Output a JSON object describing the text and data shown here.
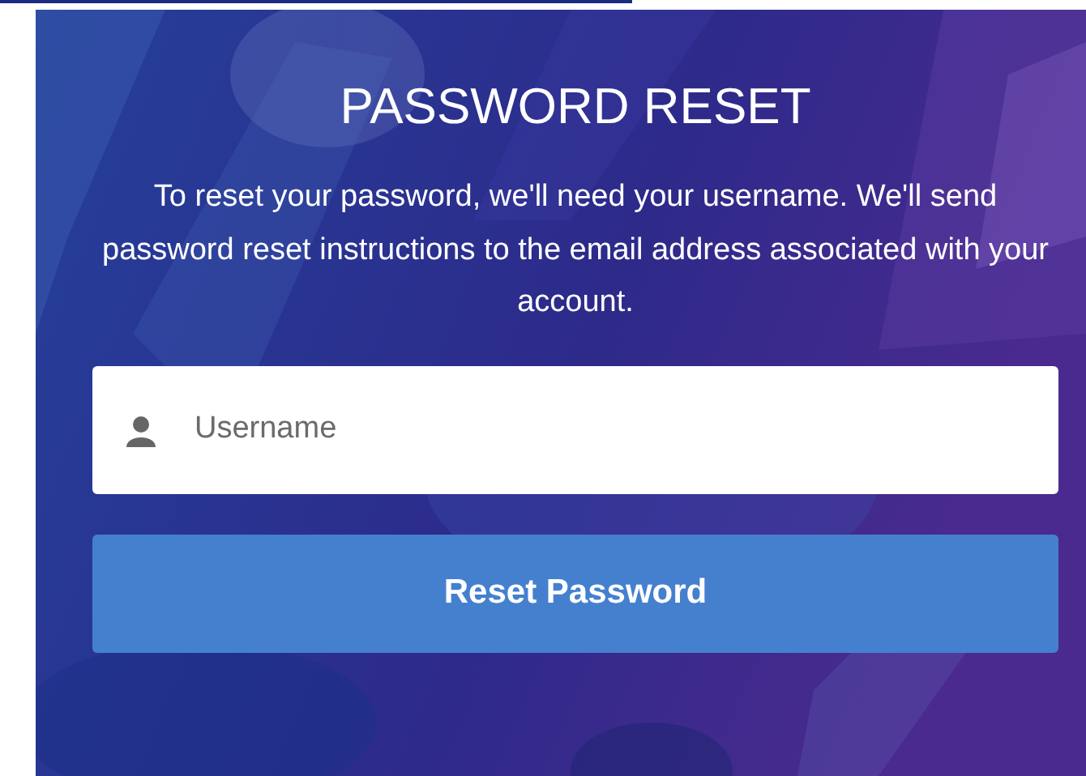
{
  "title": "PASSWORD RESET",
  "instructions": "To reset your password, we'll need your username. We'll send password reset instructions to the email address associated with your account.",
  "username_field": {
    "placeholder": "Username"
  },
  "reset_button": "Reset Password"
}
